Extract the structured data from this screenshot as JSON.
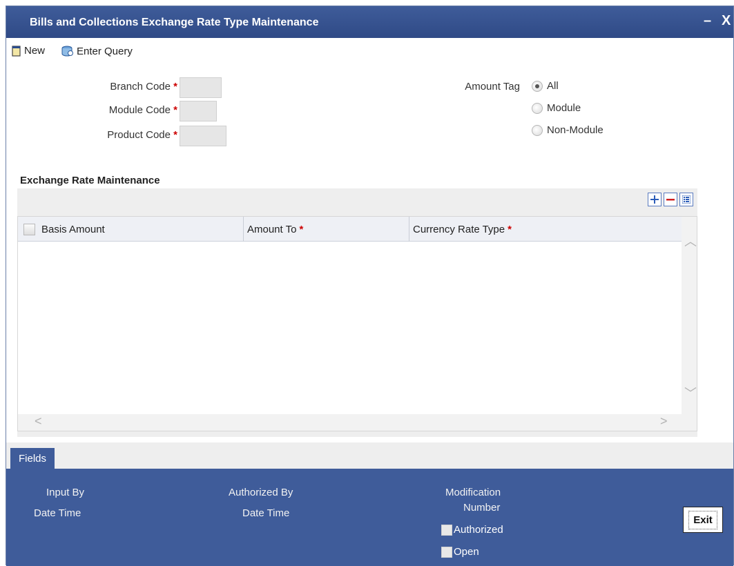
{
  "window": {
    "title": "Bills and Collections Exchange Rate Type Maintenance",
    "minimize": "–",
    "close": "X"
  },
  "toolbar": {
    "new_label": "New",
    "enter_query_label": "Enter Query"
  },
  "form": {
    "branch_code_label": "Branch Code",
    "module_code_label": "Module Code",
    "product_code_label": "Product Code",
    "required_mark": "*",
    "branch_code_value": "",
    "module_code_value": "",
    "product_code_value": "",
    "amount_tag_label": "Amount Tag",
    "amount_tag_options": [
      "All",
      "Module",
      "Non-Module"
    ],
    "amount_tag_selected": "All"
  },
  "grid": {
    "section_title": "Exchange Rate Maintenance",
    "columns": [
      "Basis Amount",
      "Amount To",
      "Currency Rate Type"
    ],
    "required_mark": "*",
    "rows": []
  },
  "fields_tab": "Fields",
  "footer": {
    "input_by": "Input By",
    "date_time_1": "Date Time",
    "authorized_by": "Authorized By",
    "date_time_2": "Date Time",
    "modification": "Modification",
    "number": "Number",
    "authorized": "Authorized",
    "open": "Open",
    "exit": "Exit"
  },
  "colors": {
    "title_bar": "#3f5c9a",
    "required": "#cc0000",
    "footer": "#3f5c9a"
  }
}
